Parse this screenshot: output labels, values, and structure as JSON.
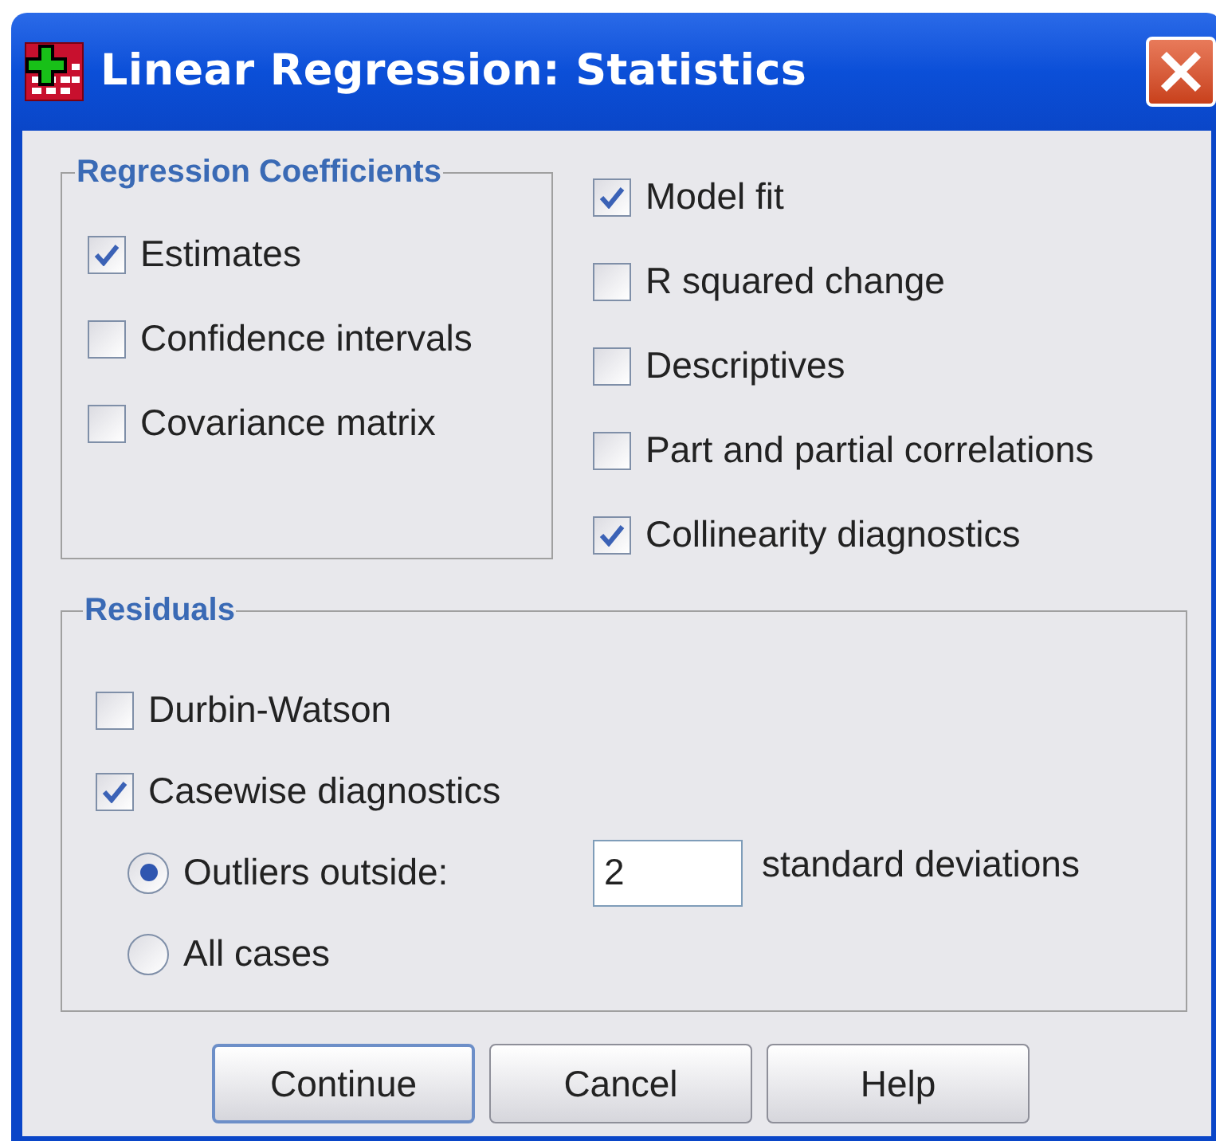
{
  "window": {
    "title": "Linear Regression: Statistics"
  },
  "regression_coefficients": {
    "title": "Regression Coefficients",
    "options": [
      {
        "label": "Estimates",
        "checked": true
      },
      {
        "label": "Confidence intervals",
        "checked": false
      },
      {
        "label": "Covariance matrix",
        "checked": false
      }
    ]
  },
  "options": [
    {
      "label": "Model fit",
      "checked": true
    },
    {
      "label": "R squared change",
      "checked": false
    },
    {
      "label": "Descriptives",
      "checked": false
    },
    {
      "label": "Part and partial correlations",
      "checked": false
    },
    {
      "label": "Collinearity diagnostics",
      "checked": true
    }
  ],
  "residuals": {
    "title": "Residuals",
    "checkboxes": [
      {
        "label": "Durbin-Watson",
        "checked": false
      },
      {
        "label": "Casewise diagnostics",
        "checked": true
      }
    ],
    "radios": [
      {
        "label": "Outliers outside:",
        "selected": true,
        "value": "2",
        "suffix": "standard deviations"
      },
      {
        "label": "All cases",
        "selected": false
      }
    ]
  },
  "buttons": [
    {
      "label": "Continue",
      "default": true
    },
    {
      "label": "Cancel",
      "default": false
    },
    {
      "label": "Help",
      "default": false
    }
  ]
}
